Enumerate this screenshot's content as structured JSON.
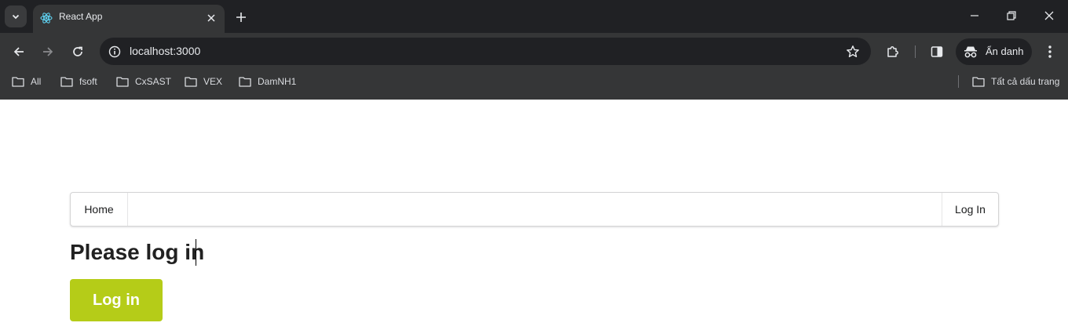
{
  "browser": {
    "tab": {
      "title": "React App"
    },
    "address_bar": {
      "url": "localhost:3000"
    },
    "profile": {
      "label": "Ẩn danh"
    },
    "bookmarks": [
      "All",
      "fsoft",
      "CxSAST",
      "VEX",
      "DamNH1"
    ],
    "all_bookmarks_label": "Tất cả dấu trang"
  },
  "app": {
    "nav": {
      "home": "Home",
      "login": "Log In"
    },
    "heading": "Please log in",
    "login_button": "Log in",
    "button_color": "#b5cc18"
  }
}
